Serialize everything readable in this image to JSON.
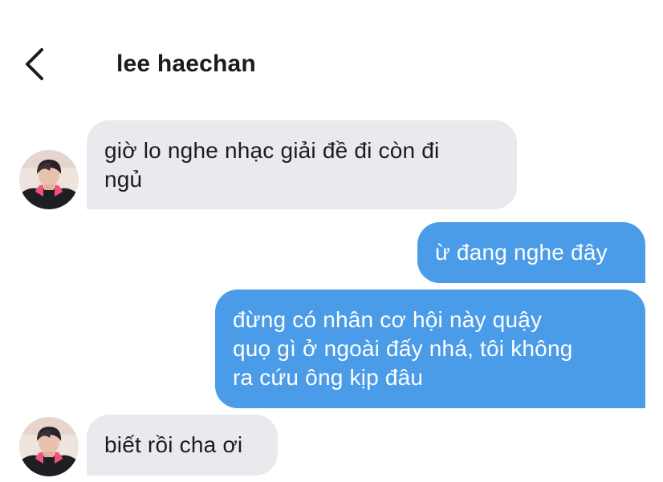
{
  "header": {
    "title": "lee haechan",
    "back_icon": "chevron-left-icon"
  },
  "colors": {
    "incoming_bubble": "#e8eaed",
    "outgoing_bubble": "#4a9be8",
    "text_dark": "#1c1c1e",
    "text_light": "#ffffff"
  },
  "messages": [
    {
      "direction": "incoming",
      "text": "giờ lo nghe nhạc giải đề đi còn đi\nngủ",
      "has_avatar": true
    },
    {
      "direction": "outgoing",
      "text": "ừ đang nghe đây",
      "has_avatar": false
    },
    {
      "direction": "outgoing",
      "text": "đừng có nhân cơ hội này quậy\nquọ gì ở ngoài đấy nhá, tôi không\nra cứu ông kịp đâu",
      "has_avatar": false
    },
    {
      "direction": "incoming",
      "text": "biết rồi cha ơi",
      "has_avatar": true
    }
  ]
}
